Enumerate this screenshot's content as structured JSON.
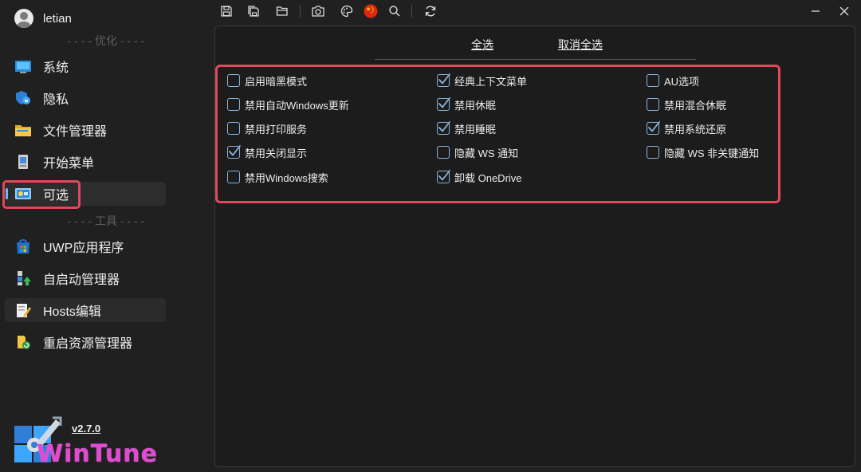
{
  "user": {
    "name": "letian"
  },
  "sidebar": {
    "section_optimize": "- - - - 优化 - - - -",
    "section_tools": "- - - - 工具 - - - -",
    "items": [
      {
        "label": "系统",
        "icon": "system-monitor-icon"
      },
      {
        "label": "隐私",
        "icon": "privacy-shield-icon"
      },
      {
        "label": "文件管理器",
        "icon": "folder-icon"
      },
      {
        "label": "开始菜单",
        "icon": "start-menu-icon"
      },
      {
        "label": "可选",
        "icon": "optional-settings-icon"
      },
      {
        "label": "UWP应用程序",
        "icon": "uwp-store-icon"
      },
      {
        "label": "自启动管理器",
        "icon": "startup-manager-icon"
      },
      {
        "label": "Hosts编辑",
        "icon": "hosts-edit-icon"
      },
      {
        "label": "重启资源管理器",
        "icon": "restart-explorer-icon"
      }
    ]
  },
  "logo": {
    "version": "v2.7.0",
    "wordmark": "WinTune"
  },
  "toolbar": {
    "icons": [
      "save-icon",
      "save-all-icon",
      "open-folder-icon",
      "camera-icon",
      "theme-palette-icon",
      "china-flag-icon",
      "search-icon",
      "refresh-icon"
    ]
  },
  "main": {
    "select_all": "全选",
    "deselect_all": "取消全选",
    "columns": [
      [
        {
          "label": "启用暗黑模式",
          "checked": false
        },
        {
          "label": "禁用自动Windows更新",
          "checked": false
        },
        {
          "label": "禁用打印服务",
          "checked": false
        },
        {
          "label": "禁用关闭显示",
          "checked": true
        },
        {
          "label": "禁用Windows搜索",
          "checked": false
        }
      ],
      [
        {
          "label": "经典上下文菜单",
          "checked": true
        },
        {
          "label": "禁用休眠",
          "checked": true
        },
        {
          "label": "禁用睡眠",
          "checked": true
        },
        {
          "label": "隐藏 WS 通知",
          "checked": false
        },
        {
          "label": "卸载 OneDrive",
          "checked": true
        }
      ],
      [
        {
          "label": "AU选项",
          "checked": false
        },
        {
          "label": "禁用混合休眠",
          "checked": false
        },
        {
          "label": "禁用系统还原",
          "checked": true
        },
        {
          "label": "隐藏 WS 非关键通知",
          "checked": false
        }
      ]
    ]
  },
  "colors": {
    "accent": "#6fb6ff",
    "highlight": "#e0485c",
    "background": "#202020",
    "panel": "#1c1c1c"
  }
}
